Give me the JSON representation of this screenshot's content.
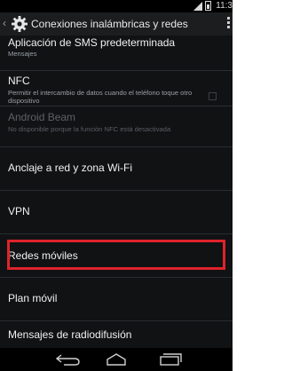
{
  "status_bar": {
    "time": "11:3",
    "signal_icon": "signal-icon",
    "battery_icon": "battery-icon"
  },
  "action_bar": {
    "title": "Conexiones inalámbricas y redes",
    "back_icon": "back-caret-icon",
    "app_icon": "settings-gear-icon",
    "overflow_icon": "overflow-menu-icon"
  },
  "list": [
    {
      "title": "Aplicación de SMS predeterminada",
      "subtitle": "Mensajes"
    },
    {
      "title": "NFC",
      "subtitle": "Permitir el intercambio de datos cuando el teléfono toque otro dispositivo",
      "checkbox": false
    },
    {
      "title": "Android Beam",
      "subtitle": "No disponible porque la función NFC está desactivada",
      "disabled": true
    },
    {
      "title": "Anclaje a red y zona Wi-Fi"
    },
    {
      "title": "VPN"
    },
    {
      "title": "Redes móviles",
      "highlighted": true
    },
    {
      "title": "Plan móvil"
    },
    {
      "title": "Mensajes de radiodifusión"
    }
  ],
  "nav_bar": {
    "back": "back-arrow-icon",
    "home": "home-icon",
    "recents": "recent-apps-icon"
  },
  "colors": {
    "background": "#101214",
    "highlight": "#e0232b",
    "text": "#f1f1f1",
    "subtext": "#9aa0a6"
  }
}
